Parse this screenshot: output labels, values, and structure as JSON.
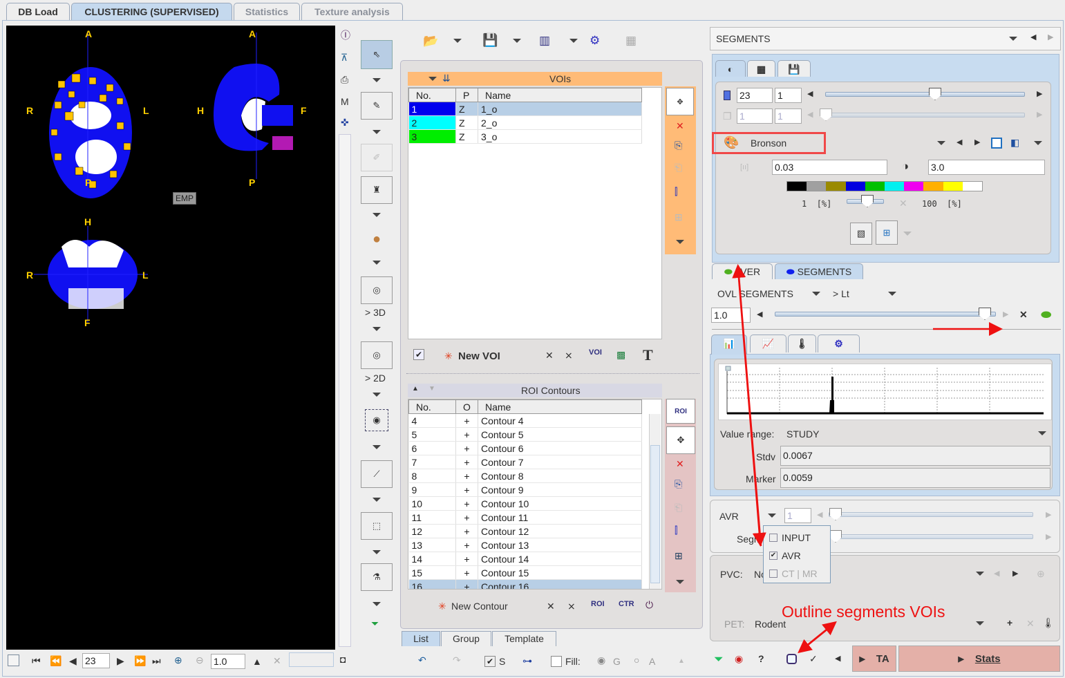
{
  "tabs": [
    {
      "label": "DB Load"
    },
    {
      "label": "CLUSTERING (SUPERVISED)"
    },
    {
      "label": "Statistics"
    },
    {
      "label": "Texture analysis"
    }
  ],
  "viewer": {
    "orient": {
      "A": "A",
      "P": "P",
      "R": "R",
      "L": "L",
      "H": "H",
      "F": "F"
    },
    "emp_label": "EMP",
    "slice": "23",
    "zoom": "1.0"
  },
  "tools": {
    "to_3d": "> 3D",
    "to_2d": "> 2D"
  },
  "vois": {
    "title": "VOIs",
    "columns": [
      "No.",
      "P",
      "Name"
    ],
    "rows": [
      {
        "no": "1",
        "p": "Z",
        "name": "1_o",
        "color": "#0000ee"
      },
      {
        "no": "2",
        "p": "Z",
        "name": "2_o",
        "color": "#00ffff"
      },
      {
        "no": "3",
        "p": "Z",
        "name": "3_o",
        "color": "#00ee00"
      }
    ],
    "new_voi": "New VOI"
  },
  "rois": {
    "title": "ROI Contours",
    "columns": [
      "No.",
      "O",
      "Name"
    ],
    "rows": [
      {
        "no": "4",
        "o": "+",
        "name": "Contour 4"
      },
      {
        "no": "5",
        "o": "+",
        "name": "Contour 5"
      },
      {
        "no": "6",
        "o": "+",
        "name": "Contour 6"
      },
      {
        "no": "7",
        "o": "+",
        "name": "Contour 7"
      },
      {
        "no": "8",
        "o": "+",
        "name": "Contour 8"
      },
      {
        "no": "9",
        "o": "+",
        "name": "Contour 9"
      },
      {
        "no": "10",
        "o": "+",
        "name": "Contour 10"
      },
      {
        "no": "11",
        "o": "+",
        "name": "Contour 11"
      },
      {
        "no": "12",
        "o": "+",
        "name": "Contour 12"
      },
      {
        "no": "13",
        "o": "+",
        "name": "Contour 13"
      },
      {
        "no": "14",
        "o": "+",
        "name": "Contour 14"
      },
      {
        "no": "15",
        "o": "+",
        "name": "Contour 15"
      },
      {
        "no": "16",
        "o": "+",
        "name": "Contour 16"
      }
    ],
    "new_contour": "New Contour",
    "roi_btn": "ROI",
    "ctr_btn": "CTR"
  },
  "list_tabs": [
    "List",
    "Group",
    "Template"
  ],
  "bottom": {
    "s_label": "S",
    "fill_label": "Fill:",
    "g_label": "G",
    "a_label": "A"
  },
  "right": {
    "series": "SEGMENTS",
    "slice": "23",
    "frame": "1",
    "slice2": "1",
    "frame2": "1",
    "colormap": "Bronson",
    "min": "0.03",
    "max": "3.0",
    "lower_pct": "1",
    "upper_pct": "100",
    "pct_unit": "[%]",
    "slice_slider_pct": 0.55,
    "colorbar": [
      "#000000",
      "#a0a0a0",
      "#9a8a00",
      "#0000e0",
      "#00c000",
      "#00f0f0",
      "#f000f0",
      "#ffb000",
      "#ffff00",
      "#ffffff"
    ],
    "layer_tabs": [
      "AVER",
      "SEGMENTS"
    ],
    "ovl": "OVL SEGMENTS",
    "ovl_mode": "> Lt",
    "opacity": "1.0",
    "opacity_pct": 0.95,
    "value_range_label": "Value range:",
    "value_range": "STUDY",
    "stdv_label": "Stdv",
    "stdv": "0.0067",
    "marker_label": "Marker",
    "marker": "0.0059",
    "avr_label": "AVR",
    "avr_value": "1",
    "segm_label": "Segm",
    "menu": [
      {
        "label": "INPUT",
        "checked": false
      },
      {
        "label": "AVR",
        "checked": true
      },
      {
        "label": "CT | MR",
        "checked": false,
        "disabled": true
      }
    ],
    "pvc_label": "PVC:",
    "pvc_value": "No",
    "pet_label": "PET:",
    "pet_value": "Rodent",
    "ta": "TA",
    "stats": "Stats"
  },
  "annotation": {
    "text": "Outline segments VOIs",
    "color": "#ee1111"
  }
}
